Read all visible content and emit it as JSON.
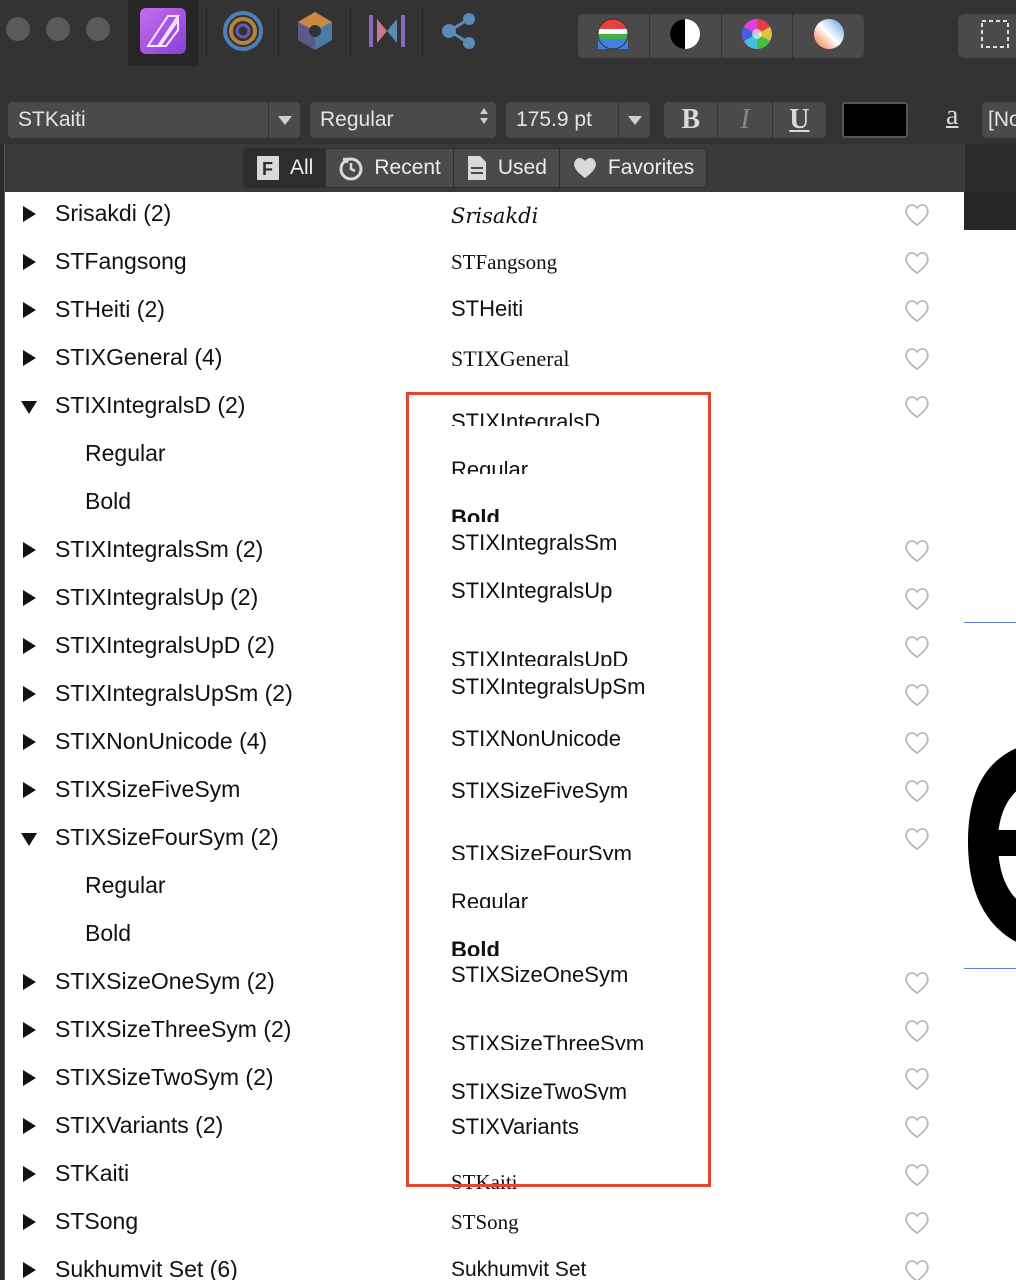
{
  "toolbar": {
    "persona_icons": [
      "designer-persona-icon",
      "photo-persona-icon",
      "pixel-persona-icon",
      "export-persona-icon",
      "share-icon"
    ],
    "color_buttons": [
      "color-wheel-icon",
      "contrast-icon",
      "hue-wheel-icon",
      "gradient-icon"
    ]
  },
  "context": {
    "font_family": "STKaiti",
    "font_style": "Regular",
    "font_size": "175.9 pt",
    "bold_label": "B",
    "italic_label": "I",
    "underline_label": "U",
    "text_color": "#000000",
    "char_label": "a",
    "style_field": "[No"
  },
  "panel": {
    "tabs": [
      {
        "label": "All",
        "icon": "font-icon",
        "active": true
      },
      {
        "label": "Recent",
        "icon": "clock-icon",
        "active": false
      },
      {
        "label": "Used",
        "icon": "document-icon",
        "active": false
      },
      {
        "label": "Favorites",
        "icon": "heart-icon",
        "active": false
      }
    ],
    "rows": [
      {
        "name": "Srisakdi (2)",
        "preview": "Srisakdi",
        "expanded": false,
        "sub": false
      },
      {
        "name": "STFangsong",
        "preview": "STFangsong",
        "expanded": false,
        "sub": false
      },
      {
        "name": "STHeiti (2)",
        "preview": "STHeiti",
        "expanded": false,
        "sub": false
      },
      {
        "name": "STIXGeneral (4)",
        "preview": "STIXGeneral",
        "expanded": false,
        "sub": false
      },
      {
        "name": "STIXIntegralsD (2)",
        "preview": "STIXIntegralsD",
        "expanded": true,
        "sub": false
      },
      {
        "name": "Regular",
        "preview": "Regular",
        "sub": true
      },
      {
        "name": "Bold",
        "preview": "Bold",
        "sub": true
      },
      {
        "name": "STIXIntegralsSm (2)",
        "preview": "STIXIntegralsSm",
        "expanded": false,
        "sub": false
      },
      {
        "name": "STIXIntegralsUp (2)",
        "preview": "STIXIntegralsUp",
        "expanded": false,
        "sub": false
      },
      {
        "name": "STIXIntegralsUpD (2)",
        "preview": "STIXIntegralsUpD",
        "expanded": false,
        "sub": false
      },
      {
        "name": "STIXIntegralsUpSm (2)",
        "preview": "STIXIntegralsUpSm",
        "expanded": false,
        "sub": false
      },
      {
        "name": "STIXNonUnicode (4)",
        "preview": "STIXNonUnicode",
        "expanded": false,
        "sub": false
      },
      {
        "name": "STIXSizeFiveSym",
        "preview": "STIXSizeFiveSym",
        "expanded": false,
        "sub": false
      },
      {
        "name": "STIXSizeFourSym (2)",
        "preview": "STIXSizeFourSym",
        "expanded": true,
        "sub": false
      },
      {
        "name": "Regular",
        "preview": "Regular",
        "sub": true
      },
      {
        "name": "Bold",
        "preview": "Bold",
        "sub": true
      },
      {
        "name": "STIXSizeOneSym (2)",
        "preview": "STIXSizeOneSym",
        "expanded": false,
        "sub": false
      },
      {
        "name": "STIXSizeThreeSym (2)",
        "preview": "STIXSizeThreeSym",
        "expanded": false,
        "sub": false
      },
      {
        "name": "STIXSizeTwoSym (2)",
        "preview": "STIXSizeTwoSym",
        "expanded": false,
        "sub": false
      },
      {
        "name": "STIXVariants (2)",
        "preview": "STIXVariants",
        "expanded": false,
        "sub": false
      },
      {
        "name": "STKaiti",
        "preview": "STKaiti",
        "expanded": false,
        "sub": false
      },
      {
        "name": "STSong",
        "preview": "STSong",
        "expanded": false,
        "sub": false
      },
      {
        "name": "Sukhumvit Set (6)",
        "preview": "Sukhumvit Set",
        "expanded": false,
        "sub": false
      }
    ]
  },
  "colors": {
    "highlight_border": "#e2462e",
    "accent_purple": "#b35be8",
    "guide_blue": "#5b7fd6"
  }
}
